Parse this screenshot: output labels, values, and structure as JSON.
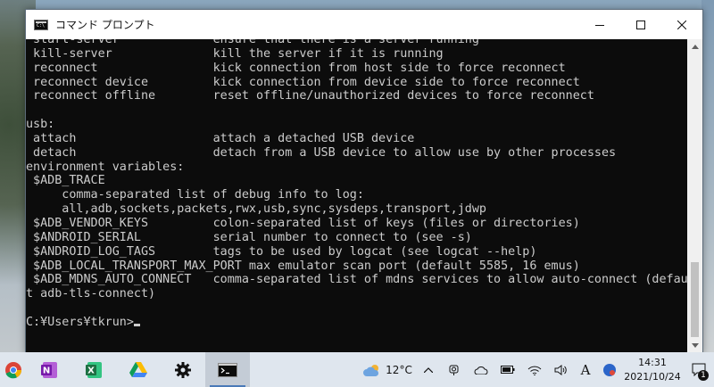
{
  "window": {
    "title": "コマンド プロンプト",
    "controls": {
      "minimize": "minimize-icon",
      "maximize": "maximize-icon",
      "close": "close-icon"
    }
  },
  "console": {
    "lines": [
      " start-server             ensure that there is a server running",
      " kill-server              kill the server if it is running",
      " reconnect                kick connection from host side to force reconnect",
      " reconnect device         kick connection from device side to force reconnect",
      " reconnect offline        reset offline/unauthorized devices to force reconnect",
      "",
      "usb:",
      " attach                   attach a detached USB device",
      " detach                   detach from a USB device to allow use by other processes",
      "environment variables:",
      " $ADB_TRACE",
      "     comma-separated list of debug info to log:",
      "     all,adb,sockets,packets,rwx,usb,sync,sysdeps,transport,jdwp",
      " $ADB_VENDOR_KEYS         colon-separated list of keys (files or directories)",
      " $ANDROID_SERIAL          serial number to connect to (see -s)",
      " $ANDROID_LOG_TAGS        tags to be used by logcat (see logcat --help)",
      " $ADB_LOCAL_TRANSPORT_MAX_PORT max emulator scan port (default 5585, 16 emus)",
      " $ADB_MDNS_AUTO_CONNECT   comma-separated list of mdns services to allow auto-connect (defaul",
      "t adb-tls-connect)",
      "",
      "C:¥Users¥tkrun>"
    ]
  },
  "taskbar": {
    "apps": [
      {
        "name": "chrome",
        "icon": "chrome-icon"
      },
      {
        "name": "onenote",
        "icon": "onenote-icon",
        "letter": "N"
      },
      {
        "name": "excel",
        "icon": "excel-icon",
        "letter": "X"
      },
      {
        "name": "google-drive",
        "icon": "google-drive-icon"
      },
      {
        "name": "settings",
        "icon": "gear-icon"
      },
      {
        "name": "command-prompt",
        "icon": "terminal-icon",
        "active": true
      }
    ],
    "weather": {
      "icon": "cloud-sun-icon",
      "temperature": "12°C"
    },
    "ime_label": "A",
    "clock": {
      "time": "14:31",
      "date": "2021/10/24"
    },
    "notification_count": "1"
  },
  "colors": {
    "console_bg": "#0c0c0c",
    "console_fg": "#cccccc",
    "taskbar_bg": "#dfe6ee",
    "onenote": "#7719aa",
    "excel": "#1d6f42"
  }
}
